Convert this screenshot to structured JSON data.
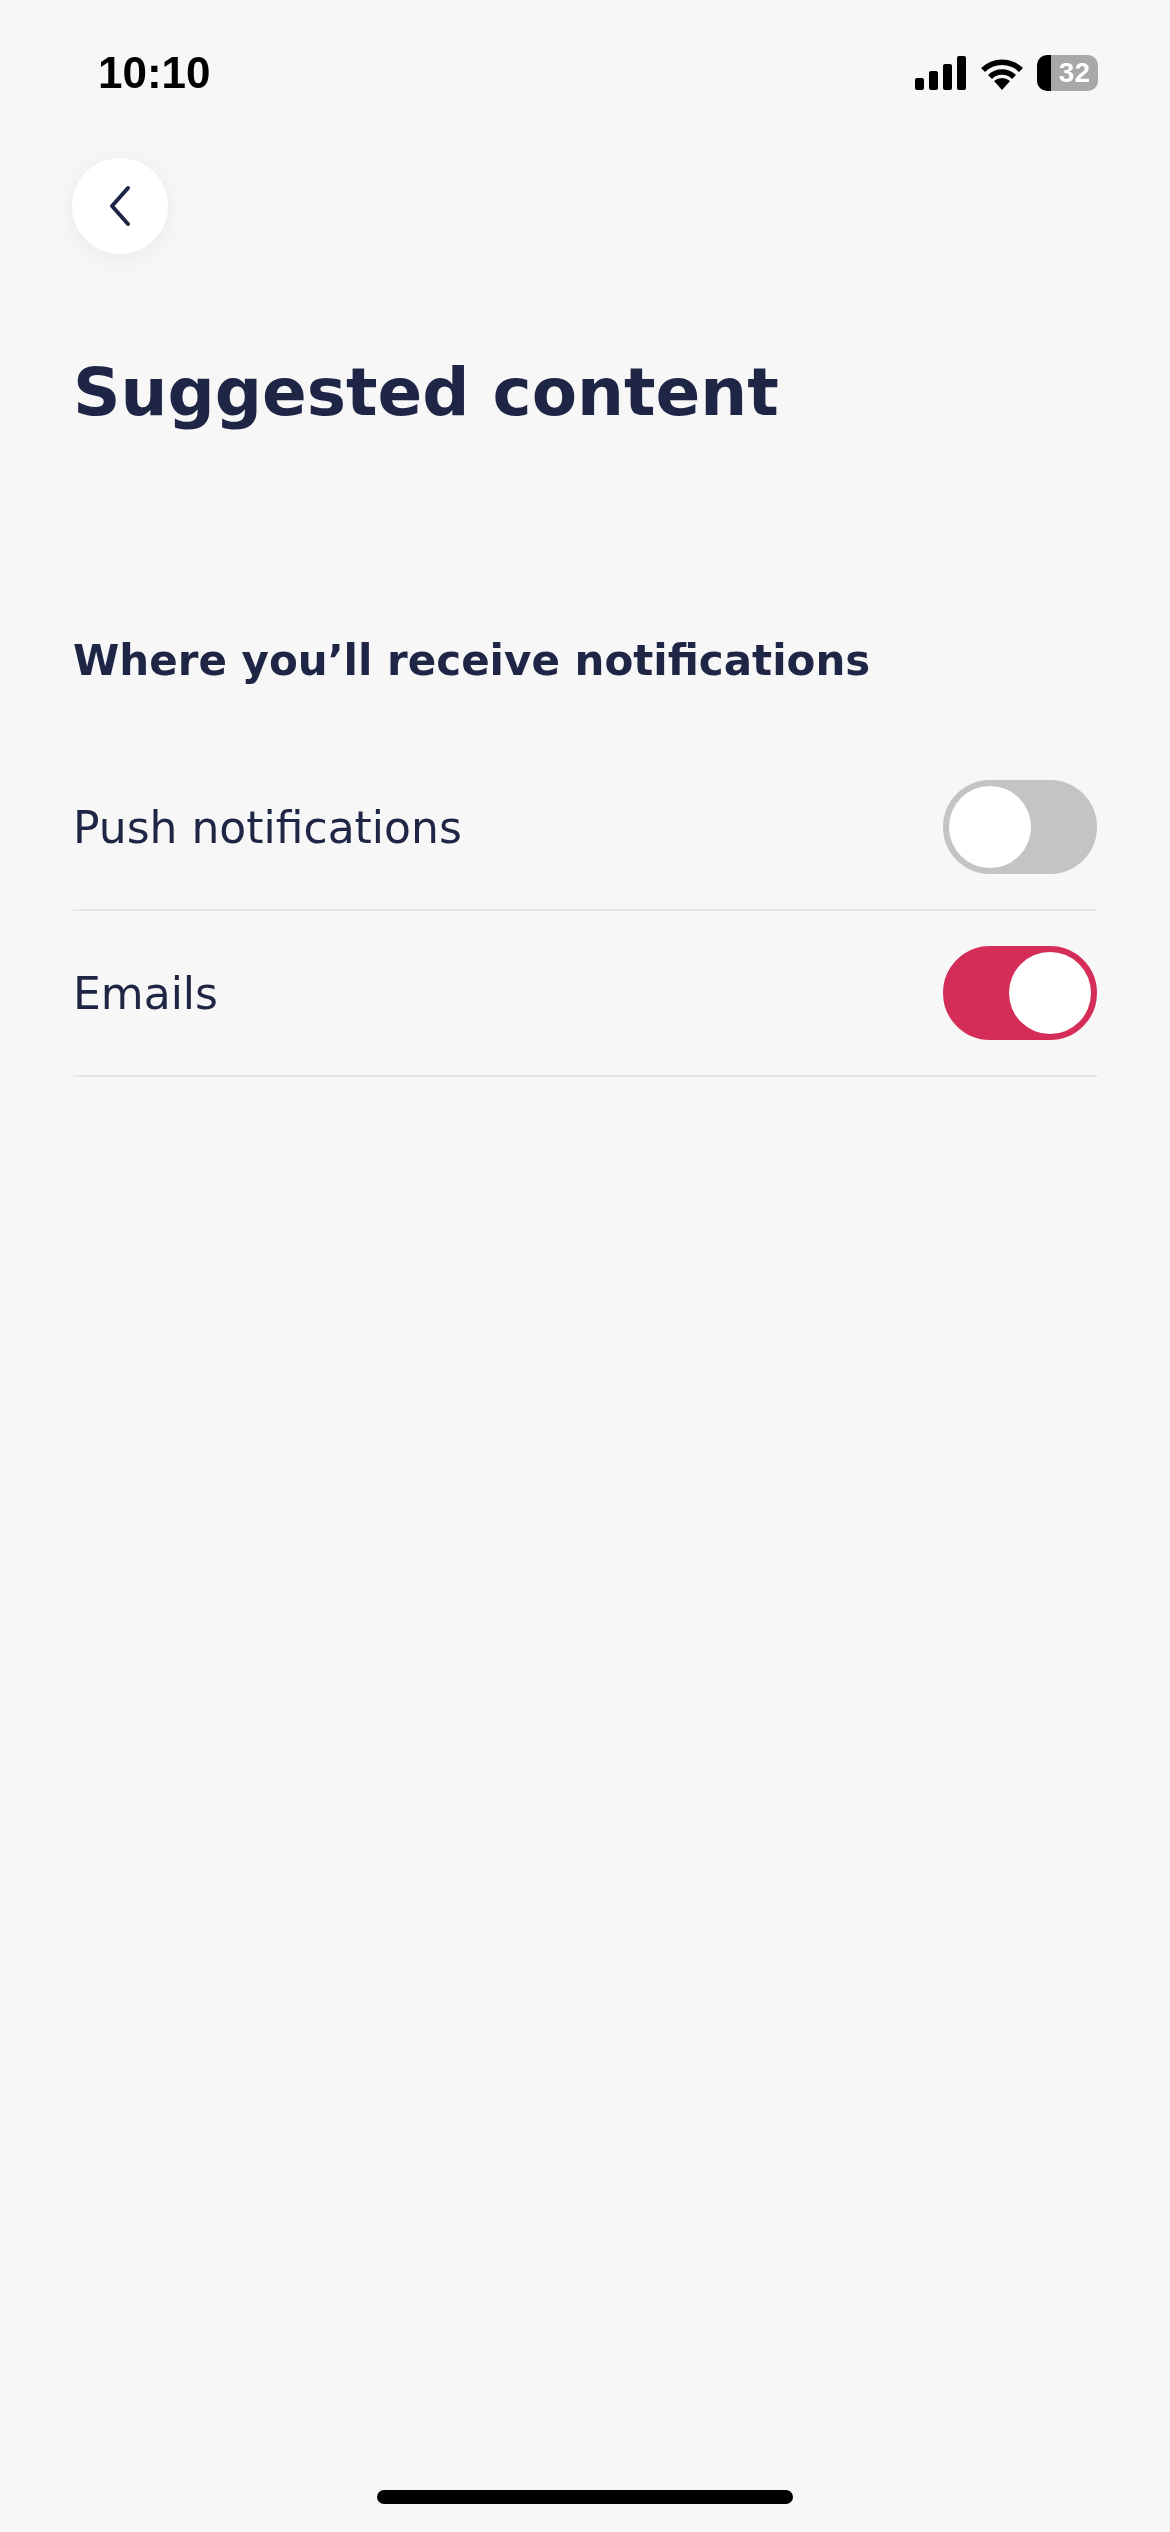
{
  "status_bar": {
    "time": "10:10",
    "battery": "32"
  },
  "title": "Suggested content",
  "section": {
    "heading": "Where you’ll receive notifications",
    "rows": [
      {
        "label": "Push notifications",
        "on": false
      },
      {
        "label": "Emails",
        "on": true
      }
    ]
  }
}
